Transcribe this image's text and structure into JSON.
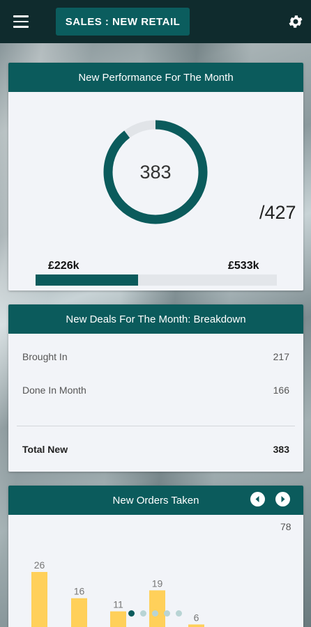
{
  "header": {
    "section_title": "SALES : NEW RETAIL"
  },
  "performance": {
    "title": "New Performance For The Month",
    "value": "383",
    "target": "/427",
    "donut_fraction": 0.897,
    "progress_left": "£226k",
    "progress_right": "£533k",
    "progress_fraction": 0.424
  },
  "breakdown": {
    "title": "New Deals For The Month: Breakdown",
    "rows": [
      {
        "label": "Brought In",
        "value": "217"
      },
      {
        "label": "Done In Month",
        "value": "166"
      }
    ],
    "total_label": "Total New",
    "total_value": "383"
  },
  "orders": {
    "title": "New Orders Taken",
    "max_label": "78",
    "pager_count": 5,
    "pager_active": 0
  },
  "colors": {
    "accent": "#0b5b5c",
    "topbar": "#0f2b2d",
    "bar": "#ffd05a"
  },
  "icons": [
    "menu-icon",
    "gear-icon",
    "chevron-left-icon",
    "chevron-right-icon"
  ],
  "chart_data": {
    "type": "bar",
    "values": [
      26,
      16,
      11,
      19,
      6
    ],
    "data_labels": [
      "26",
      "16",
      "11",
      "19",
      "6"
    ],
    "ylim": [
      0,
      78
    ]
  }
}
